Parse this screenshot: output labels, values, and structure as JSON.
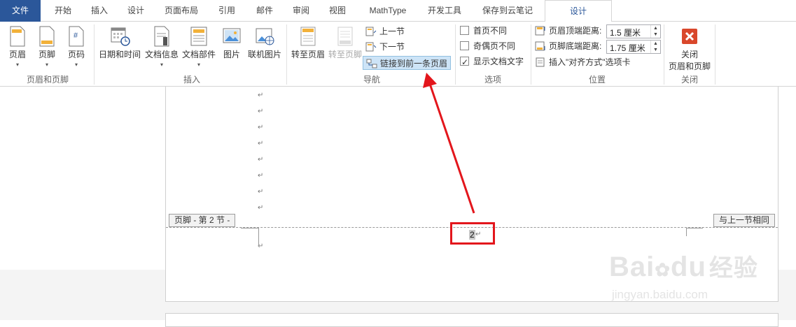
{
  "tabs": {
    "file": "文件",
    "home": "开始",
    "insert": "插入",
    "design1": "设计",
    "layout": "页面布局",
    "references": "引用",
    "mailings": "邮件",
    "review": "审阅",
    "view": "视图",
    "mathtype": "MathType",
    "developer": "开发工具",
    "save_note": "保存到云笔记",
    "design_active": "设计"
  },
  "ribbon": {
    "header_footer": {
      "header": "页眉",
      "footer": "页脚",
      "page_number": "页码",
      "group_label": "页眉和页脚"
    },
    "insert": {
      "date_time": "日期和时间",
      "doc_info": "文档信息",
      "quick_parts": "文档部件",
      "picture": "图片",
      "online_picture": "联机图片",
      "group_label": "插入"
    },
    "navigation": {
      "goto_header": "转至页眉",
      "goto_footer": "转至页脚",
      "previous": "上一节",
      "next": "下一节",
      "link_previous": "链接到前一条页眉",
      "group_label": "导航"
    },
    "options": {
      "different_first": "首页不同",
      "different_odd_even": "奇偶页不同",
      "show_text": "显示文档文字",
      "group_label": "选项"
    },
    "position": {
      "header_top_label": "页眉顶端距离:",
      "header_top_value": "1.5 厘米",
      "footer_bottom_label": "页脚底端距离:",
      "footer_bottom_value": "1.75 厘米",
      "insert_align_tab": "插入\"对齐方式\"选项卡",
      "group_label": "位置"
    },
    "close": {
      "close_line1": "关闭",
      "close_line2": "页眉和页脚",
      "group_label": "关闭"
    }
  },
  "document": {
    "paragraph_mark": "↵",
    "footer_tag": "页脚 - 第 2 节 -",
    "same_as_previous_tag": "与上一节相同",
    "page_number": "2"
  },
  "watermark": {
    "brand": "Bai",
    "brand2": "du",
    "cn": "经验",
    "url": "jingyan.baidu.com"
  },
  "colors": {
    "accent": "#2b579a",
    "highlight_red": "#e3161c",
    "close_red": "#d9472b"
  }
}
